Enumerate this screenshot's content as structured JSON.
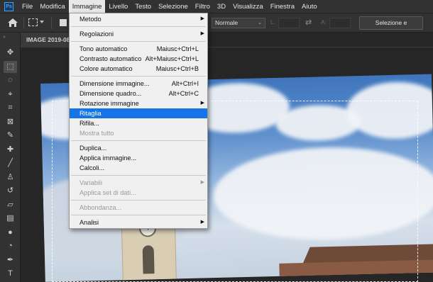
{
  "menubar": {
    "logo": "Ps",
    "items": [
      "File",
      "Modifica",
      "Immagine",
      "Livello",
      "Testo",
      "Selezione",
      "Filtro",
      "3D",
      "Visualizza",
      "Finestra",
      "Aiuto"
    ],
    "active": "Immagine"
  },
  "options_bar": {
    "blend_mode": "Normale",
    "width_label": "L:",
    "height_label": "A:",
    "select_mask_button": "Selezione e maschera..."
  },
  "toolbar": {
    "tools": [
      "move-icon",
      "rect-marquee-icon",
      "lasso-icon",
      "quick-select-icon",
      "crop-icon",
      "frame-icon",
      "eyedropper-icon",
      "healing-brush-icon",
      "brush-icon",
      "clone-stamp-icon",
      "history-brush-icon",
      "eraser-icon",
      "gradient-icon",
      "blur-icon",
      "dodge-icon",
      "pen-icon",
      "type-icon"
    ],
    "active": "rect-marquee-icon"
  },
  "document": {
    "tab_title": "IMAGE 2019-08"
  },
  "image_menu": {
    "items": [
      {
        "label": "Metodo",
        "shortcut": "",
        "submenu": true,
        "disabled": false
      },
      {
        "separator": true
      },
      {
        "label": "Regolazioni",
        "shortcut": "",
        "submenu": true,
        "disabled": false
      },
      {
        "separator": true
      },
      {
        "label": "Tono automatico",
        "shortcut": "Maiusc+Ctrl+L",
        "submenu": false,
        "disabled": false
      },
      {
        "label": "Contrasto automatico",
        "shortcut": "Alt+Maiusc+Ctrl+L",
        "submenu": false,
        "disabled": false
      },
      {
        "label": "Colore automatico",
        "shortcut": "Maiusc+Ctrl+B",
        "submenu": false,
        "disabled": false
      },
      {
        "separator": true
      },
      {
        "label": "Dimensione immagine...",
        "shortcut": "Alt+Ctrl+I",
        "submenu": false,
        "disabled": false
      },
      {
        "label": "Dimensione quadro...",
        "shortcut": "Alt+Ctrl+C",
        "submenu": false,
        "disabled": false
      },
      {
        "label": "Rotazione immagine",
        "shortcut": "",
        "submenu": true,
        "disabled": false
      },
      {
        "label": "Ritaglia",
        "shortcut": "",
        "submenu": false,
        "disabled": false,
        "highlight": true
      },
      {
        "label": "Rifila...",
        "shortcut": "",
        "submenu": false,
        "disabled": false
      },
      {
        "label": "Mostra tutto",
        "shortcut": "",
        "submenu": false,
        "disabled": true
      },
      {
        "separator": true
      },
      {
        "label": "Duplica...",
        "shortcut": "",
        "submenu": false,
        "disabled": false
      },
      {
        "label": "Applica immagine...",
        "shortcut": "",
        "submenu": false,
        "disabled": false
      },
      {
        "label": "Calcoli...",
        "shortcut": "",
        "submenu": false,
        "disabled": false
      },
      {
        "separator": true
      },
      {
        "label": "Variabili",
        "shortcut": "",
        "submenu": true,
        "disabled": true
      },
      {
        "label": "Applica set di dati...",
        "shortcut": "",
        "submenu": false,
        "disabled": true
      },
      {
        "separator": true
      },
      {
        "label": "Abbondanza...",
        "shortcut": "",
        "submenu": false,
        "disabled": true
      },
      {
        "separator": true
      },
      {
        "label": "Analisi",
        "shortcut": "",
        "submenu": true,
        "disabled": false
      }
    ]
  },
  "colors": {
    "highlight": "#1473e6",
    "menu_bg": "#f0f0f0",
    "chrome_bg": "#323232"
  }
}
